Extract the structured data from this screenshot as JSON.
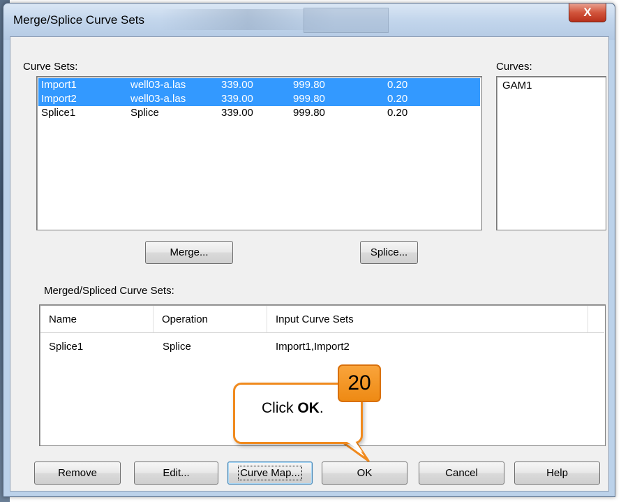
{
  "window": {
    "title": "Merge/Splice Curve Sets",
    "close_glyph": "X"
  },
  "curve_sets": {
    "label": "Curve Sets:",
    "rows": [
      {
        "name": "Import1",
        "source": "well03-a.las",
        "top": "339.00",
        "bottom": "999.80",
        "step": "0.20",
        "selected": true
      },
      {
        "name": "Import2",
        "source": "well03-a.las",
        "top": "339.00",
        "bottom": "999.80",
        "step": "0.20",
        "selected": true
      },
      {
        "name": "Splice1",
        "source": "Splice",
        "top": "339.00",
        "bottom": "999.80",
        "step": "0.20",
        "selected": false
      }
    ]
  },
  "curves": {
    "label": "Curves:",
    "items": [
      "GAM1"
    ]
  },
  "actions": {
    "merge": "Merge...",
    "splice": "Splice..."
  },
  "merged": {
    "label": "Merged/Spliced Curve Sets:",
    "columns": [
      "Name",
      "Operation",
      "Input Curve Sets"
    ],
    "rows": [
      {
        "name": "Splice1",
        "operation": "Splice",
        "inputs": "Import1,Import2"
      }
    ]
  },
  "buttons": {
    "remove": "Remove",
    "edit": "Edit...",
    "curve_map": "Curve Map...",
    "ok": "OK",
    "cancel": "Cancel",
    "help": "Help"
  },
  "callout": {
    "step": "20",
    "text_prefix": "Click ",
    "text_bold": "OK",
    "text_suffix": "."
  },
  "colors": {
    "selection": "#3399ff",
    "callout_accent": "#f08a1e"
  },
  "icons": {
    "close": "close-icon"
  }
}
